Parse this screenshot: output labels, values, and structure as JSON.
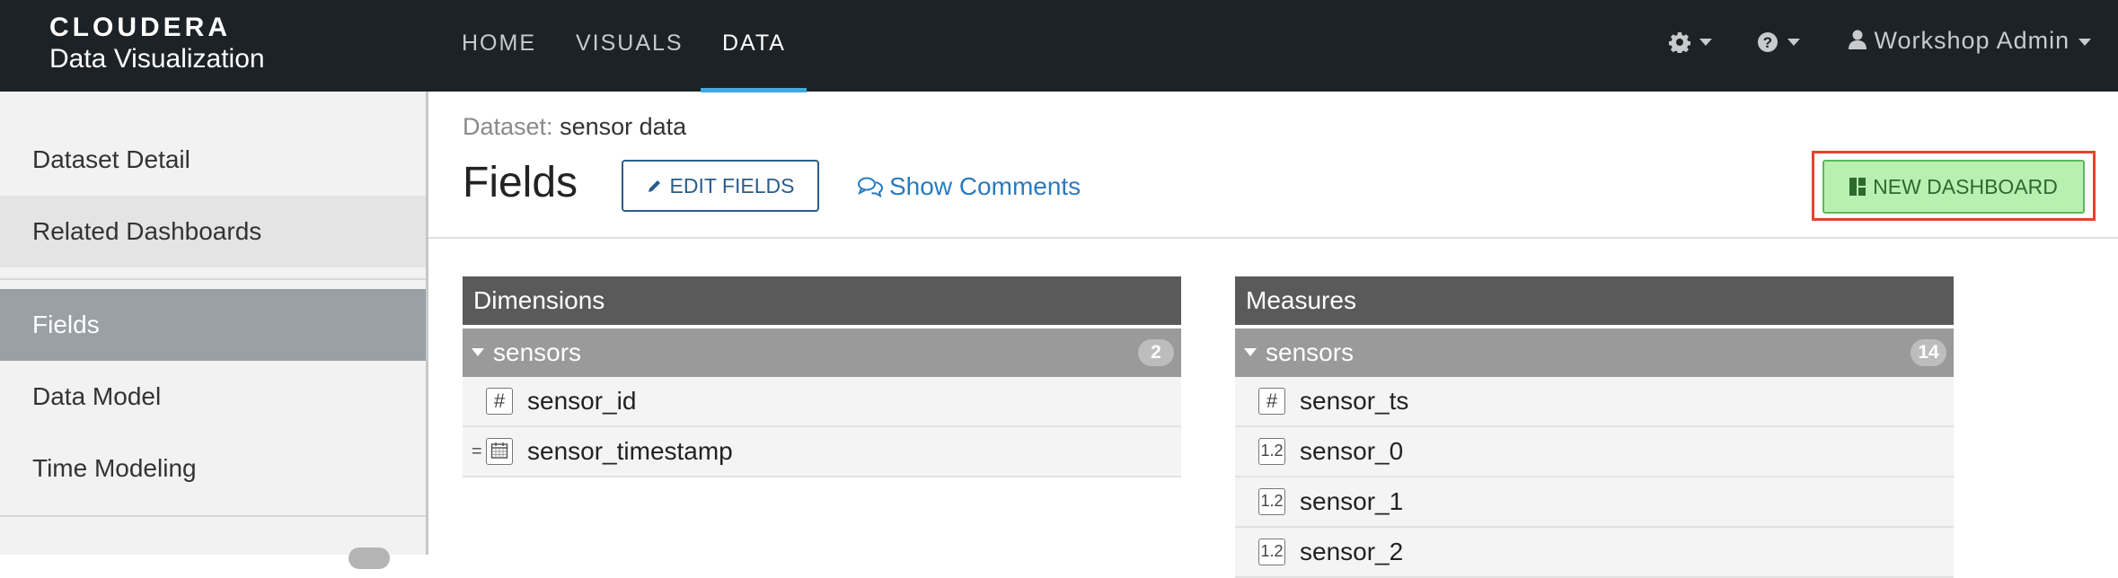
{
  "brand": {
    "top": "CLOUDERA",
    "bottom": "Data Visualization"
  },
  "nav": {
    "items": [
      "HOME",
      "VISUALS",
      "DATA"
    ],
    "active": "DATA"
  },
  "nav_right": {
    "settings_icon": "gear-icon",
    "help_icon": "question-circle-icon",
    "user_icon": "user-icon",
    "user_name": "Workshop Admin"
  },
  "sidebar": {
    "items": [
      "Dataset Detail",
      "Related Dashboards",
      "Fields",
      "Data Model",
      "Time Modeling"
    ],
    "active": "Fields"
  },
  "breadcrumb": {
    "label": "Dataset:",
    "value": "sensor data"
  },
  "page": {
    "title": "Fields",
    "edit_button": "EDIT FIELDS",
    "comments_link": "Show Comments",
    "new_dashboard_button": "NEW DASHBOARD"
  },
  "colors": {
    "nav_bg": "#1c2226",
    "accent": "#3fa9e0",
    "highlight": "#e2452a",
    "new_dashboard_bg": "#b9f0b2"
  },
  "dimensions": {
    "title": "Dimensions",
    "group": "sensors",
    "count": "2",
    "fields": [
      {
        "name": "sensor_id",
        "type_icon": "#"
      },
      {
        "name": "sensor_timestamp",
        "type_icon": "calendar"
      }
    ]
  },
  "measures": {
    "title": "Measures",
    "group": "sensors",
    "count": "14",
    "fields": [
      {
        "name": "sensor_ts",
        "type_icon": "#"
      },
      {
        "name": "sensor_0",
        "type_icon": "1.2"
      },
      {
        "name": "sensor_1",
        "type_icon": "1.2"
      },
      {
        "name": "sensor_2",
        "type_icon": "1.2"
      }
    ]
  }
}
